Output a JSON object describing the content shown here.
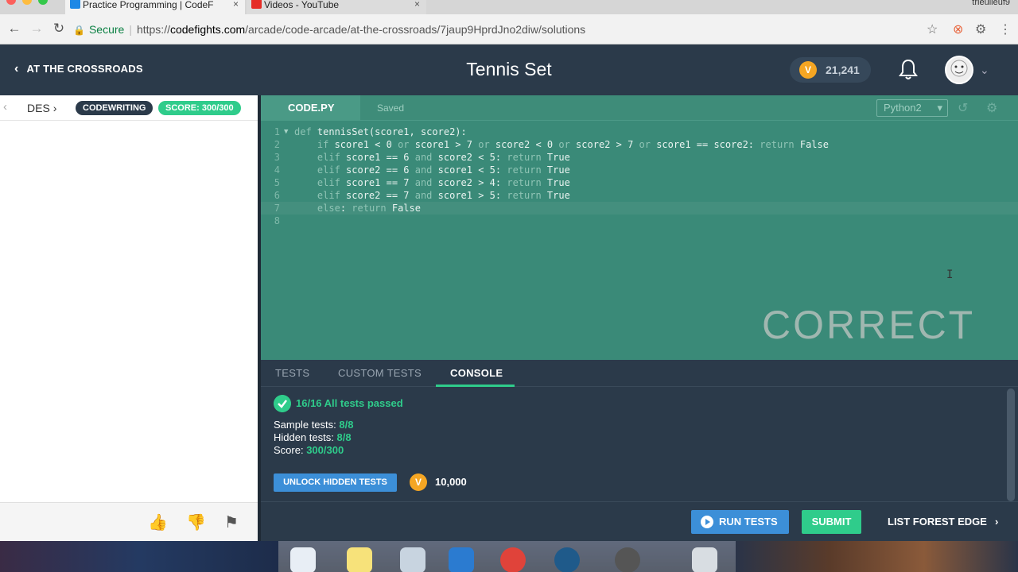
{
  "browser": {
    "tabs": [
      {
        "title": "Practice Programming | CodeF",
        "close": "×"
      },
      {
        "title": "Videos - YouTube",
        "close": "×"
      }
    ],
    "profile": "trieulieuf9",
    "secure_label": "Secure",
    "url_scheme": "https://",
    "url_host": "codefights.com",
    "url_path": "/arcade/code-arcade/at-the-crossroads/7jaup9HprdJno2diw/solutions"
  },
  "header": {
    "back_label": "AT THE CROSSROADS",
    "title": "Tennis Set",
    "coins": "21,241"
  },
  "left": {
    "tab_label": "DES",
    "pill_codewriting": "CODEWRITING",
    "pill_score": "SCORE: 300/300"
  },
  "editor": {
    "file_tab": "CODE.PY",
    "saved": "Saved",
    "language": "Python2",
    "overlay": "CORRECT",
    "lines": [
      {
        "n": "1",
        "t": "def tennisSet(score1, score2):"
      },
      {
        "n": "2",
        "t": "    if score1 < 0 or score1 > 7 or score2 < 0 or score2 > 7 or score1 == score2: return False"
      },
      {
        "n": "3",
        "t": "    elif score1 == 6 and score2 < 5: return True"
      },
      {
        "n": "4",
        "t": "    elif score2 == 6 and score1 < 5: return True"
      },
      {
        "n": "5",
        "t": "    elif score1 == 7 and score2 > 4: return True"
      },
      {
        "n": "6",
        "t": "    elif score2 == 7 and score1 > 5: return True"
      },
      {
        "n": "7",
        "t": "    else: return False"
      },
      {
        "n": "8",
        "t": ""
      }
    ]
  },
  "bottom_tabs": [
    "TESTS",
    "CUSTOM TESTS",
    "CONSOLE"
  ],
  "console": {
    "summary": "16/16 All tests passed",
    "sample_label": "Sample tests: ",
    "sample_value": "8/8",
    "hidden_label": "Hidden tests: ",
    "hidden_value": "8/8",
    "score_label": "Score: ",
    "score_value": "300/300",
    "unlock_label": "UNLOCK HIDDEN TESTS",
    "unlock_cost": "10,000"
  },
  "actions": {
    "run": "RUN TESTS",
    "submit": "SUBMIT",
    "next": "LIST FOREST EDGE"
  },
  "colors": {
    "accent_green": "#2fcc8b",
    "accent_blue": "#3c8fd8",
    "header_bg": "#2b3a4a",
    "editor_bg": "#3a8a78",
    "coin": "#f5a623"
  }
}
